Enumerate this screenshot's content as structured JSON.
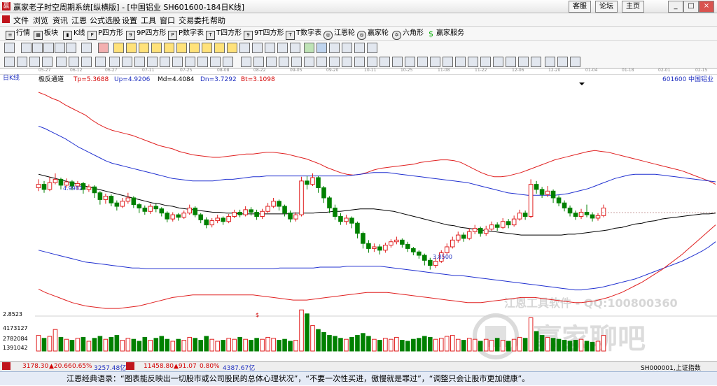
{
  "window": {
    "title": "赢家老子时空周期系统[纵横版] - [中国铝业  SH601600-184日K线]",
    "top_buttons": [
      "客服",
      "论坛",
      "主页"
    ],
    "controls": [
      "_",
      "□",
      "×"
    ]
  },
  "menu": [
    "文件",
    "浏览",
    "资讯",
    "江恩",
    "公式选股",
    "设置",
    "工具",
    "窗口",
    "交易委托",
    "帮助"
  ],
  "toolbar1": [
    "行情",
    "板块",
    "K线",
    "P四方形",
    "9P四方形",
    "P数字表",
    "T四方形",
    "9T四方形",
    "T数字表",
    "江恩轮",
    "赢家轮",
    "六角形",
    "赢家服务"
  ],
  "date_axis": [
    "05-27",
    "06-12",
    "06-27",
    "07-11",
    "07-25",
    "08-08",
    "08-22",
    "09-05",
    "09-20",
    "10-11",
    "10-25",
    "11-08",
    "11-22",
    "12-06",
    "12-20",
    "01-04",
    "01-18",
    "02-01",
    "02-15"
  ],
  "chart_header": {
    "period": "日K线",
    "indicator": "极反通道",
    "tp": "Tp=5.3688",
    "up": "Up=4.9206",
    "md": "Md=4.4084",
    "dn": "Dn=3.7292",
    "bt": "Bt=3.1098",
    "code": "601600",
    "name": "中国铝业"
  },
  "price_labels": {
    "high": "4.9982",
    "low": "3.8500",
    "axis_low": "2.8523",
    "dollar": "$"
  },
  "volume_axis": [
    "4173127",
    "2782084",
    "1391042"
  ],
  "watermark": {
    "line1": "江恩工具软件 - QQ:100800360",
    "line2": "赢家聊吧"
  },
  "status": {
    "sh_index": "3178.30",
    "sh_change": "▲20.66",
    "sh_pct": "0.65%",
    "sh_amount": "3257.48亿",
    "sz_index": "11458.80",
    "sz_change": "▲91.07",
    "sz_pct": "0.80%",
    "sz_amount": "4387.67亿",
    "right": "SH000001,上证指数"
  },
  "quote": "江恩经典语录：“图表能反映出一切股市或公司股民的总体心理状况”，“不要一次性买进，傲慢就是罪过”，“调整只会让股市更加健康”。",
  "chart_data": {
    "type": "candlestick",
    "candles": [
      [
        4.82,
        4.86,
        4.92,
        4.78
      ],
      [
        4.86,
        4.8,
        4.9,
        4.76
      ],
      [
        4.8,
        4.88,
        4.95,
        4.78
      ],
      [
        4.88,
        4.92,
        4.99,
        4.86
      ],
      [
        4.92,
        4.85,
        4.94,
        4.8
      ],
      [
        4.85,
        4.89,
        4.93,
        4.82
      ],
      [
        4.89,
        4.84,
        4.91,
        4.79
      ],
      [
        4.84,
        4.87,
        4.9,
        4.8
      ],
      [
        4.87,
        4.8,
        4.89,
        4.75
      ],
      [
        4.8,
        4.83,
        4.86,
        4.77
      ],
      [
        4.83,
        4.76,
        4.85,
        4.7
      ],
      [
        4.76,
        4.68,
        4.78,
        4.62
      ],
      [
        4.68,
        4.72,
        4.75,
        4.63
      ],
      [
        4.72,
        4.64,
        4.74,
        4.6
      ],
      [
        4.64,
        4.6,
        4.67,
        4.55
      ],
      [
        4.6,
        4.66,
        4.7,
        4.58
      ],
      [
        4.66,
        4.7,
        4.76,
        4.63
      ],
      [
        4.7,
        4.62,
        4.72,
        4.58
      ],
      [
        4.62,
        4.58,
        4.64,
        4.52
      ],
      [
        4.58,
        4.54,
        4.61,
        4.5
      ],
      [
        4.54,
        4.6,
        4.63,
        4.51
      ],
      [
        4.6,
        4.57,
        4.63,
        4.53
      ],
      [
        4.57,
        4.52,
        4.59,
        4.48
      ],
      [
        4.52,
        4.45,
        4.54,
        4.41
      ],
      [
        4.45,
        4.5,
        4.53,
        4.42
      ],
      [
        4.5,
        4.47,
        4.52,
        4.43
      ],
      [
        4.47,
        4.52,
        4.55,
        4.45
      ],
      [
        4.52,
        4.58,
        4.62,
        4.5
      ],
      [
        4.58,
        4.5,
        4.6,
        4.47
      ],
      [
        4.5,
        4.44,
        4.52,
        4.4
      ],
      [
        4.44,
        4.38,
        4.47,
        4.34
      ],
      [
        4.38,
        4.43,
        4.46,
        4.35
      ],
      [
        4.43,
        4.46,
        4.5,
        4.4
      ],
      [
        4.46,
        4.42,
        4.48,
        4.38
      ],
      [
        4.42,
        4.48,
        4.51,
        4.4
      ],
      [
        4.48,
        4.53,
        4.56,
        4.46
      ],
      [
        4.53,
        4.5,
        4.56,
        4.47
      ],
      [
        4.5,
        4.56,
        4.6,
        4.48
      ],
      [
        4.56,
        4.53,
        4.59,
        4.49
      ],
      [
        4.53,
        4.48,
        4.56,
        4.44
      ],
      [
        4.48,
        4.54,
        4.57,
        4.45
      ],
      [
        4.54,
        4.6,
        4.64,
        4.52
      ],
      [
        4.6,
        4.66,
        4.7,
        4.58
      ],
      [
        4.66,
        4.6,
        4.68,
        4.55
      ],
      [
        4.6,
        4.52,
        4.62,
        4.48
      ],
      [
        4.52,
        4.45,
        4.55,
        4.41
      ],
      [
        4.45,
        4.5,
        4.53,
        4.42
      ],
      [
        4.5,
        4.9,
        4.95,
        4.48
      ],
      [
        4.9,
        4.86,
        4.96,
        4.8
      ],
      [
        4.86,
        4.94,
        4.99,
        4.84
      ],
      [
        4.94,
        4.82,
        4.96,
        4.76
      ],
      [
        4.82,
        4.7,
        4.84,
        4.64
      ],
      [
        4.7,
        4.58,
        4.72,
        4.52
      ],
      [
        4.58,
        4.48,
        4.62,
        4.44
      ],
      [
        4.48,
        4.42,
        4.52,
        4.38
      ],
      [
        4.42,
        4.46,
        4.5,
        4.38
      ],
      [
        4.46,
        4.4,
        4.48,
        4.34
      ],
      [
        4.4,
        4.28,
        4.42,
        4.22
      ],
      [
        4.28,
        4.16,
        4.3,
        4.1
      ],
      [
        4.16,
        4.1,
        4.2,
        4.05
      ],
      [
        4.1,
        4.12,
        4.16,
        4.06
      ],
      [
        4.12,
        4.08,
        4.15,
        4.03
      ],
      [
        4.08,
        4.14,
        4.17,
        4.05
      ],
      [
        4.14,
        4.18,
        4.21,
        4.11
      ],
      [
        4.18,
        4.2,
        4.24,
        4.15
      ],
      [
        4.2,
        4.15,
        4.22,
        4.11
      ],
      [
        4.15,
        4.1,
        4.18,
        4.06
      ],
      [
        4.1,
        4.06,
        4.12,
        4.02
      ],
      [
        4.06,
        4.02,
        4.08,
        3.98
      ],
      [
        4.02,
        3.96,
        4.04,
        3.9
      ],
      [
        3.96,
        3.9,
        3.99,
        3.85
      ],
      [
        3.9,
        3.95,
        3.99,
        3.87
      ],
      [
        3.95,
        4.05,
        4.08,
        3.93
      ],
      [
        4.05,
        4.12,
        4.16,
        4.03
      ],
      [
        4.12,
        4.2,
        4.24,
        4.1
      ],
      [
        4.2,
        4.26,
        4.3,
        4.17
      ],
      [
        4.26,
        4.22,
        4.29,
        4.18
      ],
      [
        4.22,
        4.3,
        4.34,
        4.2
      ],
      [
        4.3,
        4.34,
        4.38,
        4.27
      ],
      [
        4.34,
        4.28,
        4.36,
        4.24
      ],
      [
        4.28,
        4.33,
        4.37,
        4.25
      ],
      [
        4.33,
        4.38,
        4.42,
        4.31
      ],
      [
        4.38,
        4.35,
        4.41,
        4.31
      ],
      [
        4.35,
        4.42,
        4.46,
        4.33
      ],
      [
        4.42,
        4.38,
        4.45,
        4.34
      ],
      [
        4.38,
        4.45,
        4.49,
        4.36
      ],
      [
        4.45,
        4.52,
        4.56,
        4.43
      ],
      [
        4.52,
        4.48,
        4.55,
        4.44
      ],
      [
        4.48,
        4.86,
        4.92,
        4.46
      ],
      [
        4.86,
        4.8,
        4.9,
        4.75
      ],
      [
        4.8,
        4.74,
        4.83,
        4.7
      ],
      [
        4.74,
        4.78,
        4.84,
        4.71
      ],
      [
        4.78,
        4.7,
        4.8,
        4.64
      ],
      [
        4.7,
        4.64,
        4.73,
        4.6
      ],
      [
        4.64,
        4.58,
        4.67,
        4.54
      ],
      [
        4.58,
        4.52,
        4.61,
        4.48
      ],
      [
        4.52,
        4.48,
        4.55,
        4.44
      ],
      [
        4.48,
        4.53,
        4.57,
        4.45
      ],
      [
        4.53,
        4.5,
        4.62,
        4.47
      ],
      [
        4.5,
        4.46,
        4.53,
        4.42
      ],
      [
        4.46,
        4.49,
        4.52,
        4.43
      ],
      [
        4.49,
        4.58,
        4.62,
        4.47
      ]
    ],
    "volumes": [
      1.6,
      1.3,
      1.5,
      2.2,
      1.4,
      1.2,
      1.1,
      1.3,
      1.4,
      1.0,
      1.3,
      1.5,
      1.2,
      1.4,
      1.6,
      1.1,
      1.3,
      1.2,
      1.0,
      1.4,
      1.1,
      1.3,
      1.5,
      1.2,
      1.0,
      1.2,
      1.1,
      1.4,
      1.3,
      1.1,
      1.5,
      1.2,
      1.0,
      1.1,
      1.3,
      1.2,
      1.4,
      1.2,
      1.1,
      1.3,
      1.2,
      1.4,
      1.3,
      1.1,
      1.2,
      1.0,
      1.1,
      4.2,
      3.8,
      2.6,
      2.2,
      1.9,
      1.6,
      1.5,
      1.3,
      1.2,
      1.4,
      1.6,
      1.8,
      1.5,
      1.2,
      1.1,
      1.3,
      1.2,
      1.4,
      1.1,
      1.0,
      1.2,
      1.3,
      1.5,
      1.4,
      1.2,
      1.3,
      1.5,
      1.6,
      1.2,
      1.1,
      1.3,
      1.2,
      1.0,
      1.2,
      1.1,
      1.3,
      1.1,
      1.0,
      1.2,
      1.4,
      1.3,
      3.4,
      2.0,
      1.6,
      1.4,
      1.3,
      1.2,
      1.1,
      1.0,
      1.1,
      1.2,
      1.0,
      0.9,
      1.0,
      1.6
    ],
    "bands": {
      "top_red": [
        5.95,
        5.92,
        5.88,
        5.85,
        5.8,
        5.76,
        5.72,
        5.68,
        5.62,
        5.57,
        5.53,
        5.5,
        5.48,
        5.46,
        5.44,
        5.41,
        5.38,
        5.35,
        5.32,
        5.3,
        5.28,
        5.25,
        5.23,
        5.21,
        5.2,
        5.19,
        5.18,
        5.18,
        5.19,
        5.2,
        5.21,
        5.22,
        5.22,
        5.23,
        5.24,
        5.24,
        5.23,
        5.22,
        5.2,
        5.18,
        5.16,
        5.13,
        5.1,
        5.06,
        5.03,
        5.0,
        4.98,
        4.97,
        4.98,
        5.0,
        5.03,
        5.05,
        5.06,
        5.07,
        5.08,
        5.09,
        5.1,
        5.12,
        5.13,
        5.14,
        5.15,
        5.15,
        5.14,
        5.12,
        5.08,
        5.04,
        5.0,
        4.97,
        4.95,
        4.95,
        4.96,
        4.98,
        5.0,
        5.03,
        5.06,
        5.09,
        5.12,
        5.15,
        5.17,
        5.19,
        5.21,
        5.23,
        5.25,
        5.26,
        5.25,
        5.24,
        5.22,
        5.2,
        5.18,
        5.16,
        5.14,
        5.12,
        5.1,
        5.08,
        5.06,
        5.04,
        5.02,
        4.99,
        4.96,
        4.93,
        4.9,
        4.86
      ],
      "upper_blue": [
        5.55,
        5.52,
        5.48,
        5.44,
        5.4,
        5.35,
        5.3,
        5.26,
        5.22,
        5.18,
        5.14,
        5.11,
        5.09,
        5.07,
        5.05,
        5.03,
        5.01,
        4.99,
        4.97,
        4.95,
        4.93,
        4.92,
        4.91,
        4.9,
        4.9,
        4.9,
        4.9,
        4.91,
        4.92,
        4.92,
        4.93,
        4.94,
        4.95,
        4.95,
        4.96,
        4.96,
        4.96,
        4.96,
        4.96,
        4.96,
        4.96,
        4.96,
        4.96,
        4.96,
        4.96,
        4.96,
        4.96,
        4.97,
        4.98,
        4.99,
        5.0,
        5.0,
        5.0,
        4.99,
        4.98,
        4.97,
        4.96,
        4.95,
        4.94,
        4.93,
        4.92,
        4.91,
        4.9,
        4.89,
        4.88,
        4.86,
        4.84,
        4.82,
        4.8,
        4.78,
        4.76,
        4.75,
        4.74,
        4.73,
        4.73,
        4.73,
        4.73,
        4.73,
        4.74,
        4.75,
        4.77,
        4.79,
        4.81,
        4.84,
        4.87,
        4.9,
        4.93,
        4.95,
        4.97,
        4.98,
        4.98,
        4.98,
        4.98,
        4.97,
        4.96,
        4.95,
        4.94,
        4.93,
        4.92,
        4.91,
        4.9,
        4.89
      ],
      "mid_black": [
        4.98,
        4.96,
        4.94,
        4.92,
        4.9,
        4.88,
        4.86,
        4.84,
        4.82,
        4.8,
        4.78,
        4.76,
        4.74,
        4.72,
        4.7,
        4.68,
        4.66,
        4.64,
        4.63,
        4.61,
        4.6,
        4.58,
        4.57,
        4.56,
        4.55,
        4.54,
        4.53,
        4.53,
        4.52,
        4.52,
        4.51,
        4.51,
        4.51,
        4.51,
        4.51,
        4.51,
        4.51,
        4.51,
        4.52,
        4.52,
        4.52,
        4.52,
        4.53,
        4.53,
        4.54,
        4.54,
        4.55,
        4.56,
        4.57,
        4.57,
        4.57,
        4.56,
        4.55,
        4.54,
        4.52,
        4.5,
        4.48,
        4.46,
        4.44,
        4.42,
        4.4,
        4.38,
        4.37,
        4.35,
        4.34,
        4.33,
        4.32,
        4.31,
        4.3,
        4.29,
        4.28,
        4.27,
        4.26,
        4.26,
        4.26,
        4.26,
        4.26,
        4.26,
        4.26,
        4.27,
        4.27,
        4.28,
        4.29,
        4.3,
        4.31,
        4.32,
        4.34,
        4.35,
        4.37,
        4.39,
        4.4,
        4.42,
        4.43,
        4.45,
        4.46,
        4.47,
        4.48,
        4.49,
        4.5,
        4.51,
        4.51,
        4.52
      ],
      "lower_blue": [
        4.08,
        4.06,
        4.04,
        4.02,
        4.0,
        3.98,
        3.96,
        3.94,
        3.93,
        3.92,
        3.91,
        3.9,
        3.89,
        3.88,
        3.87,
        3.87,
        3.86,
        3.86,
        3.86,
        3.86,
        3.86,
        3.86,
        3.86,
        3.86,
        3.86,
        3.86,
        3.86,
        3.86,
        3.86,
        3.86,
        3.86,
        3.86,
        3.86,
        3.86,
        3.86,
        3.86,
        3.87,
        3.87,
        3.87,
        3.87,
        3.87,
        3.87,
        3.88,
        3.88,
        3.88,
        3.88,
        3.89,
        3.89,
        3.89,
        3.89,
        3.89,
        3.89,
        3.88,
        3.87,
        3.86,
        3.85,
        3.84,
        3.83,
        3.82,
        3.81,
        3.8,
        3.79,
        3.78,
        3.78,
        3.77,
        3.76,
        3.75,
        3.74,
        3.73,
        3.72,
        3.71,
        3.7,
        3.69,
        3.68,
        3.67,
        3.66,
        3.65,
        3.64,
        3.63,
        3.62,
        3.61,
        3.61,
        3.62,
        3.63,
        3.64,
        3.66,
        3.68,
        3.7,
        3.72,
        3.74,
        3.77,
        3.8,
        3.83,
        3.86,
        3.89,
        3.92,
        3.95,
        3.99,
        4.03,
        4.07,
        4.12,
        4.18
      ],
      "bottom_red": [
        3.62,
        3.58,
        3.55,
        3.52,
        3.49,
        3.46,
        3.44,
        3.42,
        3.41,
        3.4,
        3.39,
        3.39,
        3.39,
        3.4,
        3.41,
        3.42,
        3.44,
        3.46,
        3.48,
        3.5,
        3.52,
        3.53,
        3.54,
        3.55,
        3.55,
        3.55,
        3.55,
        3.55,
        3.55,
        3.55,
        3.55,
        3.55,
        3.55,
        3.54,
        3.53,
        3.52,
        3.51,
        3.5,
        3.49,
        3.49,
        3.49,
        3.5,
        3.51,
        3.52,
        3.53,
        3.54,
        3.55,
        3.56,
        3.57,
        3.58,
        3.58,
        3.58,
        3.58,
        3.57,
        3.56,
        3.55,
        3.54,
        3.53,
        3.52,
        3.51,
        3.5,
        3.49,
        3.48,
        3.47,
        3.46,
        3.46,
        3.46,
        3.47,
        3.48,
        3.49,
        3.5,
        3.51,
        3.52,
        3.52,
        3.52,
        3.51,
        3.5,
        3.49,
        3.48,
        3.47,
        3.46,
        3.46,
        3.47,
        3.48,
        3.5,
        3.52,
        3.55,
        3.58,
        3.62,
        3.66,
        3.7,
        3.75,
        3.8,
        3.85,
        3.91,
        3.97,
        4.03,
        4.1,
        4.17,
        4.24,
        4.31,
        4.38
      ]
    },
    "price_range": [
      3.3,
      6.0
    ]
  }
}
